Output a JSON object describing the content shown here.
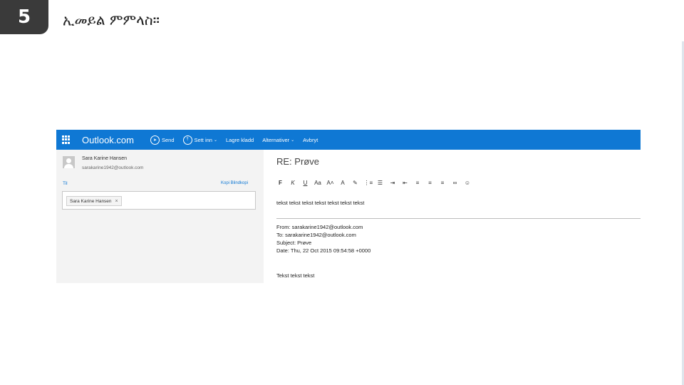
{
  "slide": {
    "number": "5",
    "title": "ኢመይል ምምላስ።"
  },
  "app": {
    "brand": "Outlook.com",
    "commands": [
      {
        "label": "Send",
        "icon": "send-icon",
        "chevron": false
      },
      {
        "label": "Sett inn",
        "icon": "insert-icon",
        "chevron": true
      },
      {
        "label": "Lagre kladd",
        "icon": "",
        "chevron": false
      },
      {
        "label": "Alternativer",
        "icon": "",
        "chevron": true
      },
      {
        "label": "Avbryt",
        "icon": "",
        "chevron": false
      }
    ]
  },
  "sender": {
    "name": "Sara Karine Hansen",
    "email": "sarakarine1942@outlook.com"
  },
  "to": {
    "label": "Til",
    "links": "Kopi  Blindkopi",
    "recipient": "Sara Karine Hansen",
    "remove_glyph": "×"
  },
  "compose": {
    "subject": "RE: Prøve",
    "toolbar": [
      {
        "name": "bold-button",
        "glyph": "F"
      },
      {
        "name": "italic-button",
        "glyph": "K"
      },
      {
        "name": "underline-button",
        "glyph": "U"
      },
      {
        "name": "font-size-button",
        "glyph": "Aa"
      },
      {
        "name": "grow-font-button",
        "glyph": "A˄"
      },
      {
        "name": "font-color-button",
        "glyph": "A"
      },
      {
        "name": "highlight-button",
        "glyph": "✎"
      },
      {
        "name": "numbered-list-button",
        "glyph": "⋮≡"
      },
      {
        "name": "bullet-list-button",
        "glyph": "☰"
      },
      {
        "name": "indent-button",
        "glyph": "⇥"
      },
      {
        "name": "outdent-button",
        "glyph": "⇤"
      },
      {
        "name": "align-left-button",
        "glyph": "≡"
      },
      {
        "name": "align-center-button",
        "glyph": "≡"
      },
      {
        "name": "align-right-button",
        "glyph": "≡"
      },
      {
        "name": "link-button",
        "glyph": "∞"
      },
      {
        "name": "emoji-button",
        "glyph": "☺"
      }
    ],
    "body_text": "tekst tekst tekst tekst tekst tekst tekst",
    "header_lines": [
      "From: sarakarine1942@outlook.com",
      "To: sarakarine1942@outlook.com",
      "Subject: Prøve",
      "Date: Thu, 22 Oct 2015 09:54:58 +0000"
    ],
    "quoted_text": "Tekst tekst tekst"
  }
}
